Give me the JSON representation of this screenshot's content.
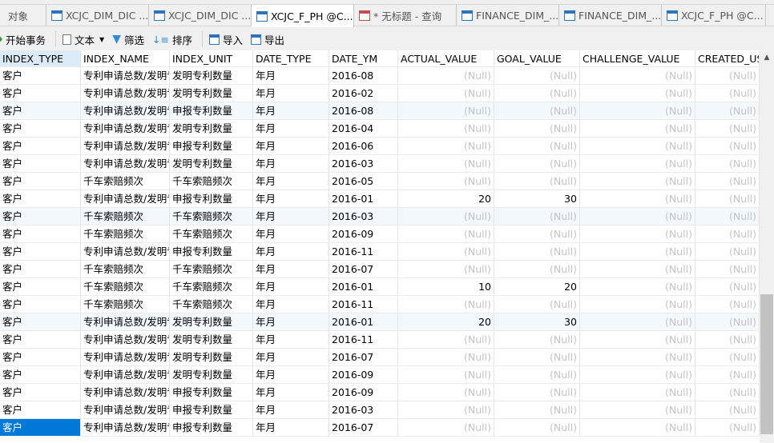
{
  "tabs": [
    {
      "label": "对象",
      "icon": "none"
    },
    {
      "label": "XCJC_DIM_DIC ...",
      "icon": "table-edit-icon"
    },
    {
      "label": "XCJC_DIM_DIC ...",
      "icon": "table-icon"
    },
    {
      "label": "XCJC_F_PH @C...",
      "icon": "table-icon",
      "active": true
    },
    {
      "label": "* 无标题 - 查询",
      "icon": "query-icon"
    },
    {
      "label": "FINANCE_DIM_...",
      "icon": "table-edit-icon"
    },
    {
      "label": "FINANCE_DIM_...",
      "icon": "table-icon"
    },
    {
      "label": "XCJC_F_PH @C...",
      "icon": "table-edit-icon"
    }
  ],
  "toolbar": {
    "begin_transaction": "开始事务",
    "text": "文本",
    "filter": "筛选",
    "sort": "排序",
    "import": "导入",
    "export": "导出"
  },
  "columns": [
    "INDEX_TYPE",
    "INDEX_NAME",
    "INDEX_UNIT",
    "DATE_TYPE",
    "DATE_YM",
    "ACTUAL_VALUE",
    "GOAL_VALUE",
    "CHALLENGE_VALUE",
    "CREATED_US"
  ],
  "null_text": "(Null)",
  "rows": [
    [
      "客户",
      "专利申请总数/发明专",
      "发明专利数量",
      "年月",
      "2016-08",
      null,
      null,
      null,
      null
    ],
    [
      "客户",
      "专利申请总数/发明专",
      "发明专利数量",
      "年月",
      "2016-02",
      null,
      null,
      null,
      null
    ],
    [
      "客户",
      "专利申请总数/发明专",
      "申报专利数量",
      "年月",
      "2016-08",
      null,
      null,
      null,
      null
    ],
    [
      "客户",
      "专利申请总数/发明专",
      "发明专利数量",
      "年月",
      "2016-04",
      null,
      null,
      null,
      null
    ],
    [
      "客户",
      "专利申请总数/发明专",
      "申报专利数量",
      "年月",
      "2016-06",
      null,
      null,
      null,
      null
    ],
    [
      "客户",
      "专利申请总数/发明专",
      "发明专利数量",
      "年月",
      "2016-03",
      null,
      null,
      null,
      null
    ],
    [
      "客户",
      "千车索赔频次",
      "千车索赔频次",
      "年月",
      "2016-05",
      null,
      null,
      null,
      null
    ],
    [
      "客户",
      "专利申请总数/发明专",
      "申报专利数量",
      "年月",
      "2016-01",
      "20",
      "30",
      null,
      null
    ],
    [
      "客户",
      "千车索赔频次",
      "千车索赔频次",
      "年月",
      "2016-03",
      null,
      null,
      null,
      null
    ],
    [
      "客户",
      "千车索赔频次",
      "千车索赔频次",
      "年月",
      "2016-09",
      null,
      null,
      null,
      null
    ],
    [
      "客户",
      "专利申请总数/发明专",
      "申报专利数量",
      "年月",
      "2016-11",
      null,
      null,
      null,
      null
    ],
    [
      "客户",
      "千车索赔频次",
      "千车索赔频次",
      "年月",
      "2016-07",
      null,
      null,
      null,
      null
    ],
    [
      "客户",
      "千车索赔频次",
      "千车索赔频次",
      "年月",
      "2016-01",
      "10",
      "20",
      null,
      null
    ],
    [
      "客户",
      "千车索赔频次",
      "千车索赔频次",
      "年月",
      "2016-11",
      null,
      null,
      null,
      null
    ],
    [
      "客户",
      "专利申请总数/发明专",
      "发明专利数量",
      "年月",
      "2016-01",
      "20",
      "30",
      null,
      null
    ],
    [
      "客户",
      "专利申请总数/发明专",
      "发明专利数量",
      "年月",
      "2016-11",
      null,
      null,
      null,
      null
    ],
    [
      "客户",
      "专利申请总数/发明专",
      "发明专利数量",
      "年月",
      "2016-07",
      null,
      null,
      null,
      null
    ],
    [
      "客户",
      "专利申请总数/发明专",
      "发明专利数量",
      "年月",
      "2016-09",
      null,
      null,
      null,
      null
    ],
    [
      "客户",
      "专利申请总数/发明专",
      "申报专利数量",
      "年月",
      "2016-09",
      null,
      null,
      null,
      null
    ],
    [
      "客户",
      "专利申请总数/发明专",
      "申报专利数量",
      "年月",
      "2016-03",
      null,
      null,
      null,
      null
    ],
    [
      "客户",
      "专利申请总数/发明专",
      "申报专利数量",
      "年月",
      "2016-07",
      null,
      null,
      null,
      null
    ]
  ]
}
